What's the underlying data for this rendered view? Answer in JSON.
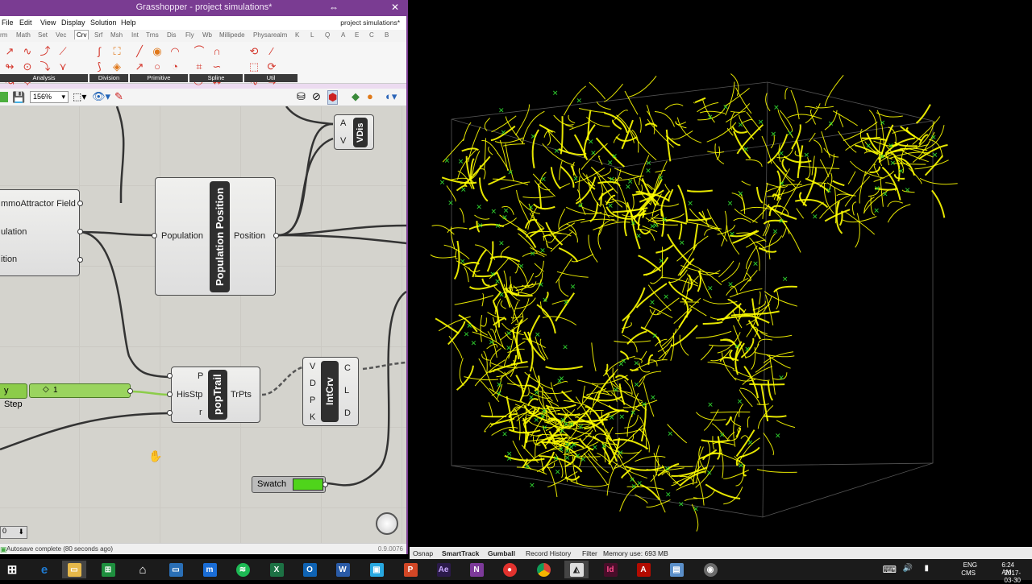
{
  "grasshopper": {
    "title": "Grasshopper - project simulations*",
    "document_name": "project simulations*",
    "menu": [
      "File",
      "Edit",
      "View",
      "Display",
      "Solution",
      "Help"
    ],
    "tabs": [
      "rm",
      "Math",
      "Set",
      "Vec",
      "Crv",
      "Srf",
      "Msh",
      "Int",
      "Trns",
      "Dis",
      "Fly",
      "Wb",
      "Millipede",
      "Physarealm",
      "K",
      "L",
      "Q",
      "A",
      "E",
      "C",
      "B"
    ],
    "active_tab": "Crv",
    "ribbon_groups": [
      "Analysis",
      "Division",
      "Primitive",
      "Spline",
      "Util"
    ],
    "zoom": "156%",
    "components": {
      "attractor": {
        "ports": [
          "mmoAttractor Field",
          "ulation",
          "ition"
        ]
      },
      "population_position": {
        "name": "Population Position",
        "input": "Population",
        "output": "Position"
      },
      "vdis": {
        "name": "VDis",
        "inputs": [
          "A",
          "V"
        ]
      },
      "poptrail": {
        "name": "popTrail",
        "inputs": [
          "P",
          "HisStp",
          "r"
        ],
        "output": "TrPts"
      },
      "intcrv": {
        "name": "IntCrv",
        "inputs": [
          "V",
          "D",
          "P",
          "K"
        ],
        "outputs": [
          "C",
          "L",
          "D"
        ]
      },
      "slider": {
        "label": "y Step",
        "value": "1"
      },
      "swatch": {
        "label": "Swatch",
        "color": "#4fd41b"
      }
    },
    "zoom_corner_value": "0",
    "status": "Autosave complete (80 seconds ago)",
    "version": "0.9.0076"
  },
  "rhino": {
    "status_items": [
      "Osnap",
      "SmartTrack",
      "Gumball",
      "Record History",
      "Filter",
      "Memory use: 693 MB"
    ],
    "active_status": [
      "SmartTrack",
      "Gumball"
    ],
    "trail_color": "#ffff00",
    "agent_color": "#2fd12f"
  },
  "taskbar": {
    "apps": [
      "windows",
      "ie",
      "explorer",
      "store",
      "home",
      "remote-desktop",
      "maxthon",
      "spotify",
      "excel",
      "outlook",
      "word",
      "photos",
      "powerpoint",
      "after-effects",
      "onenote",
      "app-red",
      "chrome",
      "rhino",
      "indesign",
      "acrobat",
      "image-viewer",
      "screen-tool",
      "obs"
    ],
    "lang": "ENG",
    "lang2": "CMS",
    "time": "6:24 AM",
    "date": "2017-03-30"
  }
}
